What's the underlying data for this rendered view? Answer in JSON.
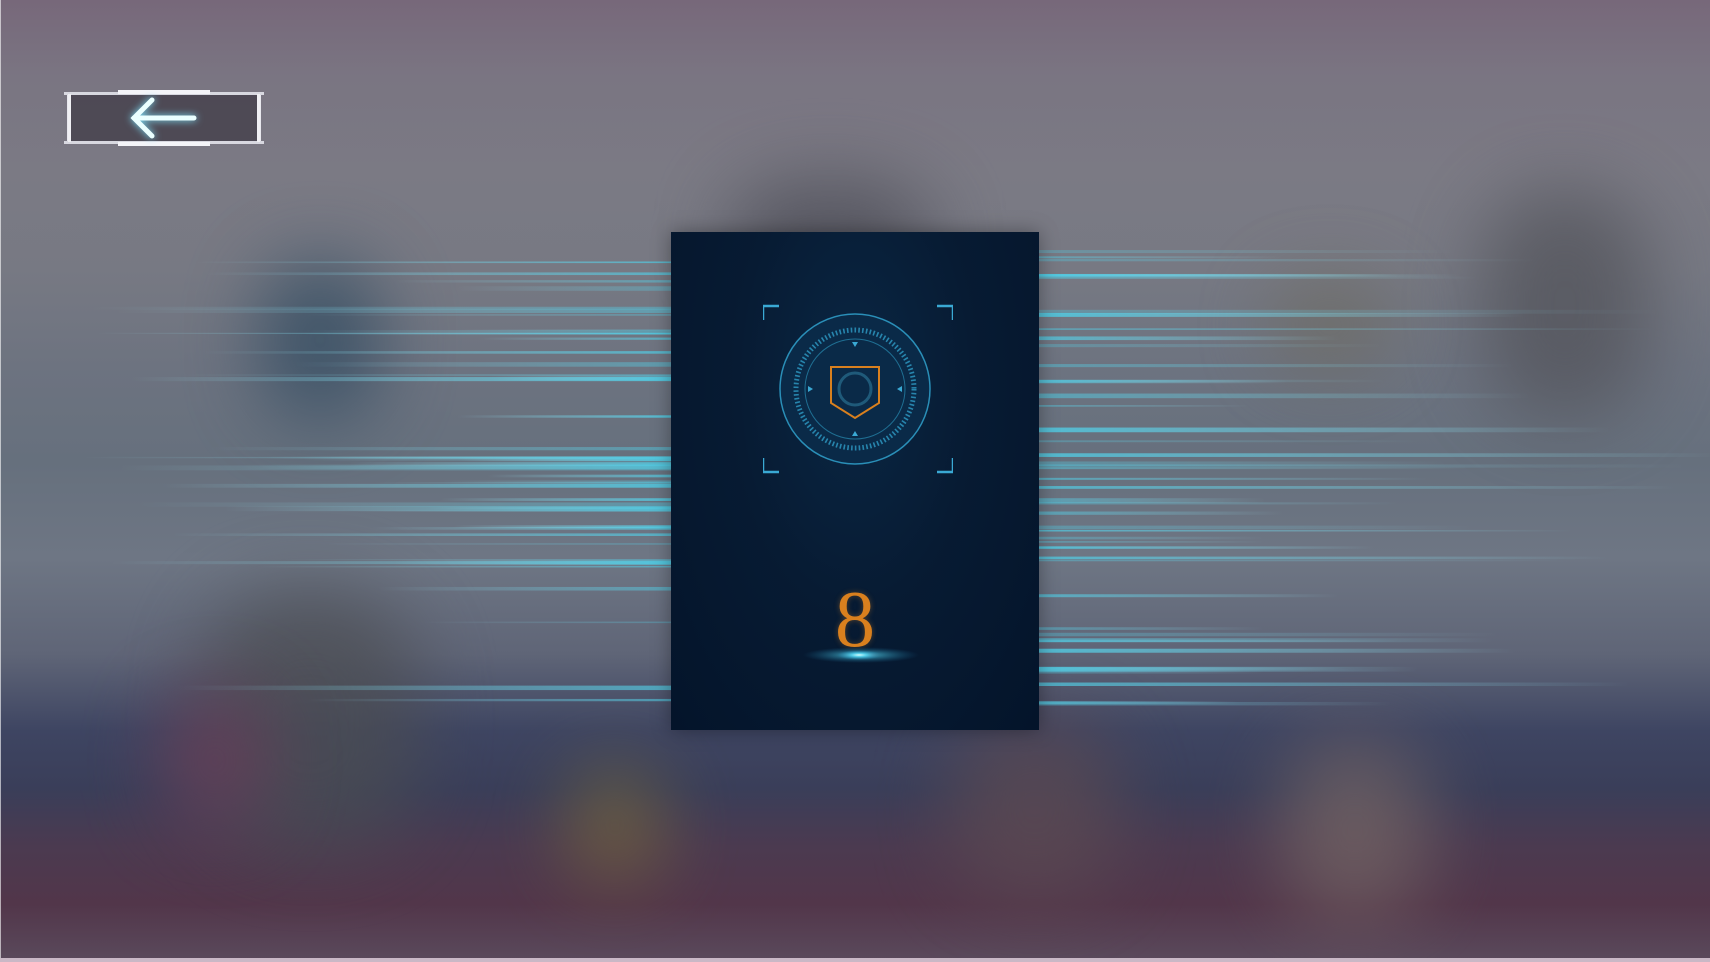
{
  "back_button": {
    "icon": "arrow-left-icon"
  },
  "card": {
    "emblem_icon": "shield-target-icon",
    "number": "8"
  },
  "colors": {
    "card_background": "#04142a",
    "accent_cyan": "#4fc8e0",
    "number_orange": "#d9801e",
    "emblem_ring": "#2a8fb8"
  }
}
